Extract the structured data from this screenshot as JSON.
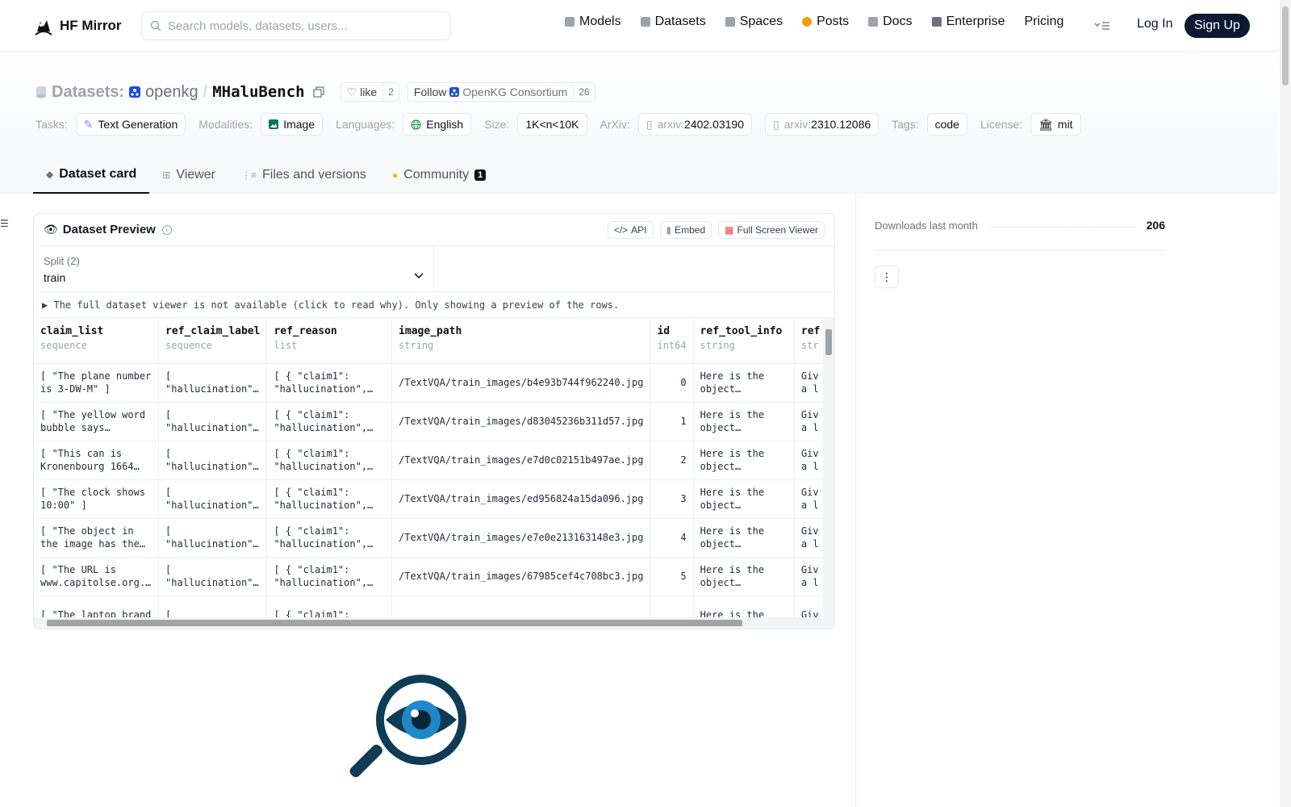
{
  "nav": {
    "brand": "HF Mirror",
    "search_placeholder": "Search models, datasets, users...",
    "links": [
      {
        "label": "Models",
        "icon": "models-icon",
        "color": "#9ca3af"
      },
      {
        "label": "Datasets",
        "icon": "datasets-icon",
        "color": "#9ca3af"
      },
      {
        "label": "Spaces",
        "icon": "spaces-icon",
        "color": "#9ca3af"
      },
      {
        "label": "Posts",
        "icon": "posts-icon",
        "color": "#f59e0b"
      },
      {
        "label": "Docs",
        "icon": "docs-icon",
        "color": "#9ca3af"
      },
      {
        "label": "Enterprise",
        "icon": "enterprise-icon",
        "color": "#6b7280"
      },
      {
        "label": "Pricing",
        "icon": "",
        "color": ""
      }
    ],
    "login": "Log In",
    "signup": "Sign Up"
  },
  "header": {
    "section": "Datasets:",
    "org": "openkg",
    "slash": "/",
    "name": "MHaluBench",
    "like_label": "like",
    "like_count": "2",
    "follow_label": "Follow",
    "follow_org": "OpenKG Consortium",
    "follow_count": "26",
    "tasks_label": "Tasks:",
    "task": "Text Generation",
    "modalities_label": "Modalities:",
    "modality": "Image",
    "languages_label": "Languages:",
    "language": "English",
    "size_label": "Size:",
    "size": "1K<n<10K",
    "arxiv_label": "ArXiv:",
    "arxiv_prefix": "arxiv:",
    "arxiv": [
      "2402.03190",
      "2310.12086"
    ],
    "tags_label": "Tags:",
    "tag": "code",
    "license_label": "License:",
    "license": "mit"
  },
  "tabs": [
    {
      "label": "Dataset card",
      "active": true
    },
    {
      "label": "Viewer",
      "active": false
    },
    {
      "label": "Files and versions",
      "active": false
    },
    {
      "label": "Community",
      "active": false,
      "badge": "1"
    }
  ],
  "preview": {
    "title": "Dataset Preview",
    "api": "API",
    "embed": "Embed",
    "fullscreen": "Full Screen Viewer",
    "split_label": "Split (2)",
    "split_value": "train",
    "notice": "The full dataset viewer is not available (click to read why). Only showing a preview of the rows.",
    "columns": [
      {
        "name": "claim_list",
        "type": "sequence"
      },
      {
        "name": "ref_claim_label",
        "type": "sequence"
      },
      {
        "name": "ref_reason",
        "type": "list"
      },
      {
        "name": "image_path",
        "type": "string"
      },
      {
        "name": "id",
        "type": "int64"
      },
      {
        "name": "ref_tool_info",
        "type": "string"
      },
      {
        "name": "ref",
        "type": "str"
      }
    ],
    "rows": [
      [
        "[ \"The plane number is 3-DW-M\" ]",
        "[ \"hallucination\"…",
        "[ { \"claim1\": \"hallucination\",…",
        "/TextVQA/train_images/b4e93b744f962240.jpg",
        "0",
        "Here is the object detectio…",
        "Giv a l"
      ],
      [
        "[ \"The yellow word bubble says…",
        "[ \"hallucination\"…",
        "[ { \"claim1\": \"hallucination\",…",
        "/TextVQA/train_images/d83045236b311d57.jpg",
        "1",
        "Here is the object detectio…",
        "Giv a l"
      ],
      [
        "[ \"This can is Kronenbourg 1664…",
        "[ \"hallucination\"…",
        "[ { \"claim1\": \"hallucination\",…",
        "/TextVQA/train_images/e7d0c02151b497ae.jpg",
        "2",
        "Here is the object detectio…",
        "Giv a l"
      ],
      [
        "[ \"The clock shows 10:00\" ]",
        "[ \"hallucination\"…",
        "[ { \"claim1\": \"hallucination\",…",
        "/TextVQA/train_images/ed956824a15da096.jpg",
        "3",
        "Here is the object detectio…",
        "Giv a l"
      ],
      [
        "[ \"The object in the image has the number…",
        "[ \"hallucination\"…",
        "[ { \"claim1\": \"hallucination\",…",
        "/TextVQA/train_images/e7e0e213163148e3.jpg",
        "4",
        "Here is the object detectio…",
        "Giv a l"
      ],
      [
        "[ \"The URL is www.capitolse.org.uk…",
        "[ \"hallucination\"…",
        "[ { \"claim1\": \"hallucination\",…",
        "/TextVQA/train_images/67985cef4c708bc3.jpg",
        "5",
        "Here is the object detectio…",
        "Giv a l"
      ],
      [
        "[ \"The laptop brand",
        "[",
        "[ { \"claim1\":",
        "",
        "",
        "Here is the",
        "Giv"
      ]
    ]
  },
  "side": {
    "downloads_label": "Downloads last month",
    "downloads": "206",
    "menu_icon": "kebab-icon"
  }
}
